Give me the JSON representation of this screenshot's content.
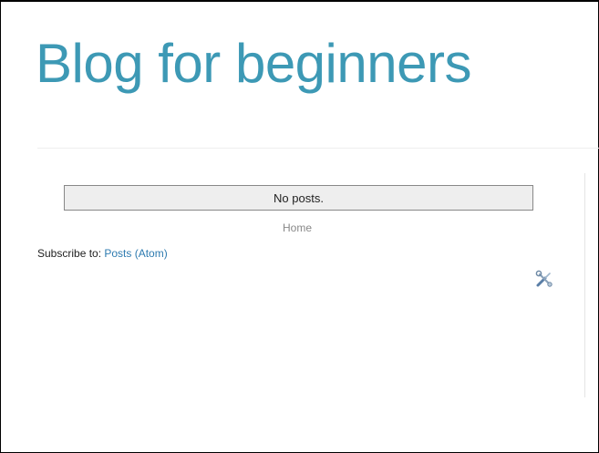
{
  "header": {
    "title": "Blog for beginners"
  },
  "main": {
    "status_message": "No posts.",
    "home_link": "Home",
    "subscribe_prefix": "Subscribe to: ",
    "subscribe_link": "Posts (Atom)"
  },
  "icons": {
    "edit_tools": "tools-icon"
  },
  "colors": {
    "title": "#3d99b5",
    "link": "#2e7bb0",
    "muted_link": "#888888",
    "status_box_bg": "#eeeeee"
  }
}
